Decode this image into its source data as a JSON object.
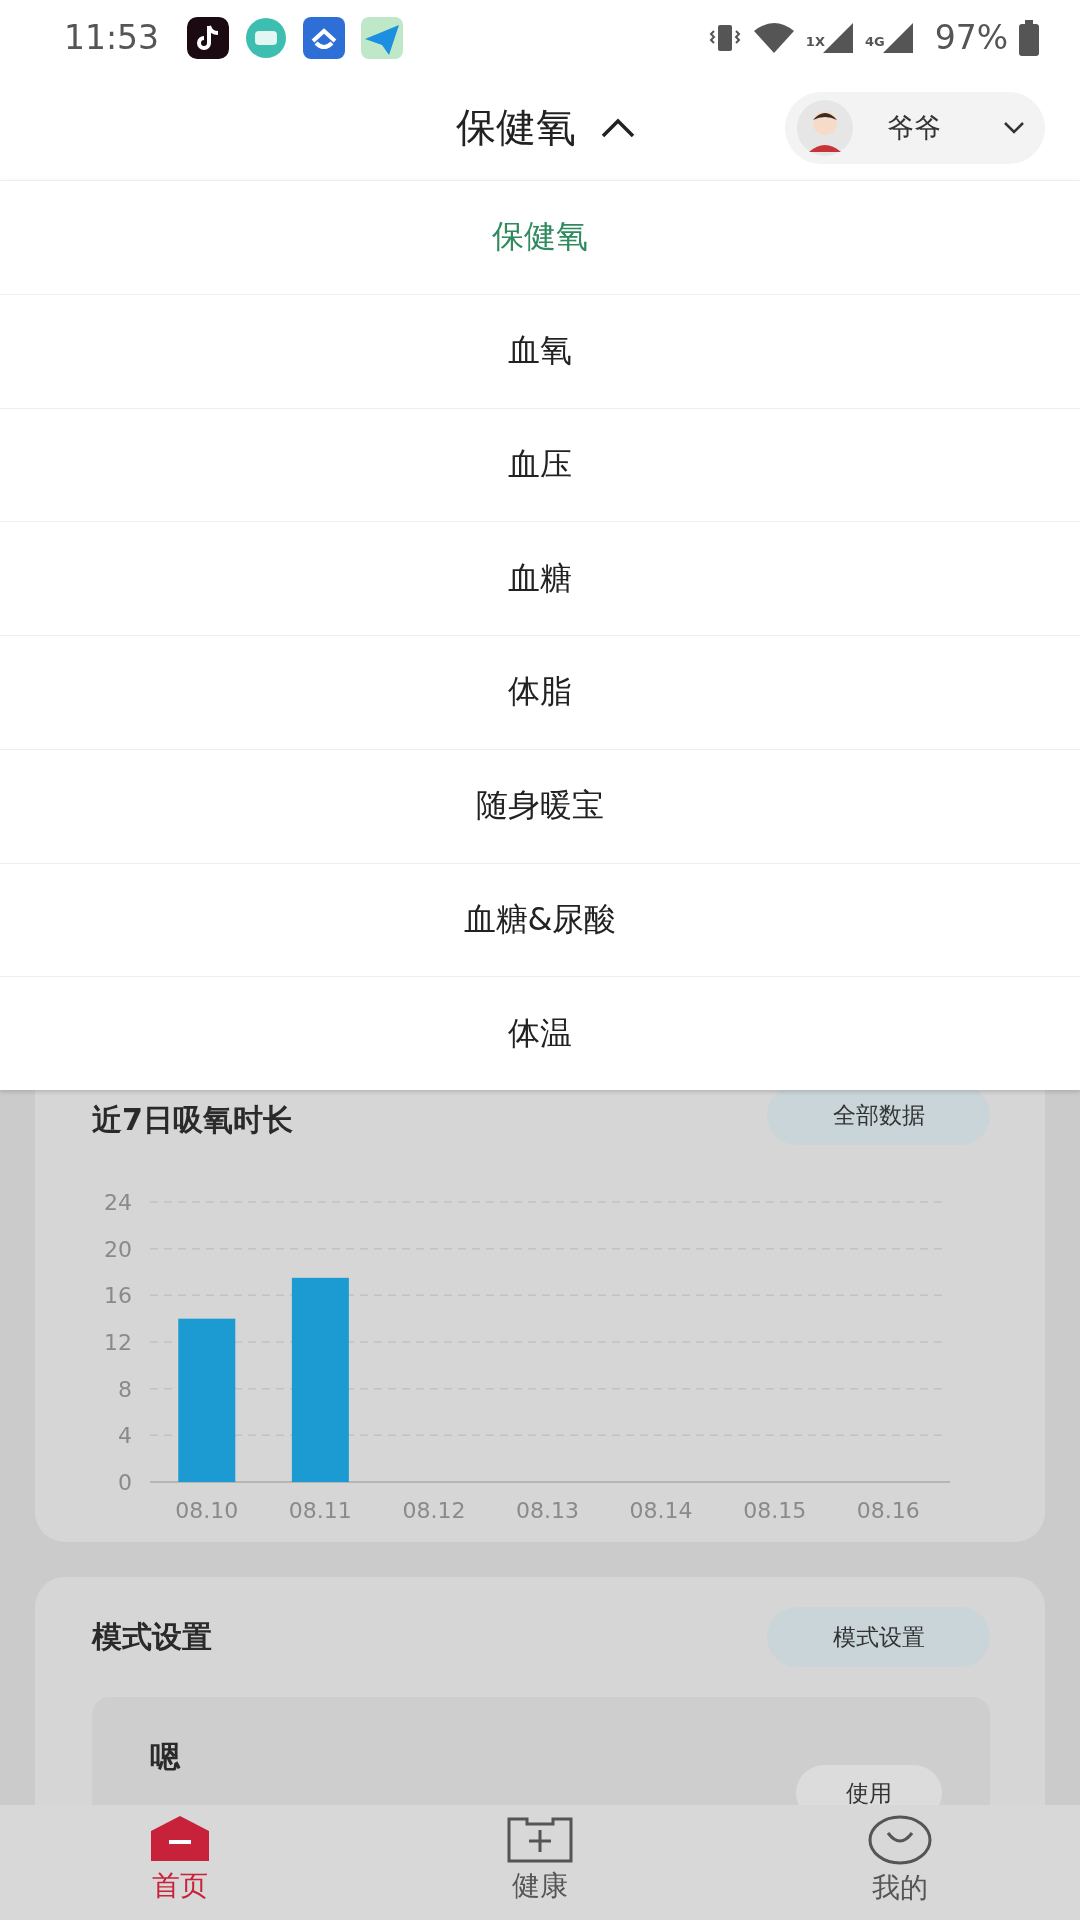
{
  "status_bar": {
    "time": "11:53",
    "network_1": "1X",
    "network_2": "4G",
    "battery": "97%"
  },
  "header": {
    "title": "保健氧",
    "expanded": true,
    "user": {
      "name": "爷爷"
    }
  },
  "menu": {
    "items": [
      {
        "label": "保健氧",
        "selected": true
      },
      {
        "label": "血氧",
        "selected": false
      },
      {
        "label": "血压",
        "selected": false
      },
      {
        "label": "血糖",
        "selected": false
      },
      {
        "label": "体脂",
        "selected": false
      },
      {
        "label": "随身暖宝",
        "selected": false
      },
      {
        "label": "血糖&尿酸",
        "selected": false
      },
      {
        "label": "体温",
        "selected": false
      }
    ]
  },
  "oxygen_card": {
    "title": "近7日吸氧时长",
    "button": "全部数据",
    "chart_data": {
      "type": "bar",
      "categories": [
        "08.10",
        "08.11",
        "08.12",
        "08.13",
        "08.14",
        "08.15",
        "08.16"
      ],
      "values": [
        14,
        17.5,
        0,
        0,
        0,
        0,
        0
      ],
      "grid": true,
      "ylim": [
        0,
        24
      ],
      "yticks": [
        0,
        4,
        8,
        12,
        16,
        20,
        24
      ]
    }
  },
  "mode_card": {
    "title": "模式设置",
    "button": "模式设置",
    "mode": {
      "name": "嗯",
      "button": "使用"
    }
  },
  "tab_bar": {
    "tabs": [
      {
        "label": "首页",
        "kind": "home",
        "selected": true
      },
      {
        "label": "健康",
        "kind": "health",
        "selected": false
      },
      {
        "label": "我的",
        "kind": "me",
        "selected": false
      }
    ]
  }
}
